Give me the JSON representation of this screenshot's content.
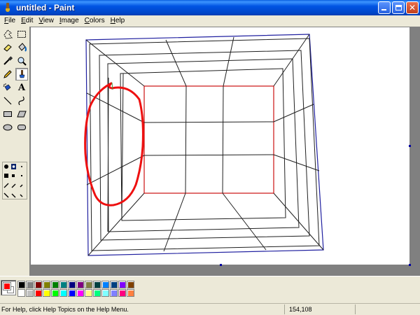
{
  "window": {
    "title": "untitled - Paint",
    "buttons": {
      "minimize": "minimize",
      "maximize": "maximize",
      "close": "✕"
    }
  },
  "menu": {
    "items": [
      "File",
      "Edit",
      "View",
      "Image",
      "Colors",
      "Help"
    ]
  },
  "toolbox": {
    "tools": [
      {
        "name": "free-form-select-icon"
      },
      {
        "name": "select-icon"
      },
      {
        "name": "eraser-icon"
      },
      {
        "name": "fill-icon"
      },
      {
        "name": "pick-color-icon"
      },
      {
        "name": "magnifier-icon"
      },
      {
        "name": "pencil-icon"
      },
      {
        "name": "brush-icon",
        "selected": true
      },
      {
        "name": "airbrush-icon"
      },
      {
        "name": "text-icon",
        "glyph": "A"
      },
      {
        "name": "line-icon"
      },
      {
        "name": "curve-icon"
      },
      {
        "name": "rectangle-icon"
      },
      {
        "name": "polygon-icon"
      },
      {
        "name": "ellipse-icon"
      },
      {
        "name": "rounded-rectangle-icon"
      }
    ]
  },
  "colors": {
    "foreground": "#ff0000",
    "background": "#ffffff",
    "palette": [
      "#000000",
      "#808080",
      "#800000",
      "#808000",
      "#008000",
      "#008080",
      "#000080",
      "#800080",
      "#808040",
      "#004040",
      "#0080ff",
      "#004080",
      "#8000ff",
      "#804000",
      "#ffffff",
      "#c0c0c0",
      "#ff0000",
      "#ffff00",
      "#00ff00",
      "#00ffff",
      "#0000ff",
      "#ff00ff",
      "#ffff80",
      "#00ff80",
      "#80ffff",
      "#8080ff",
      "#ff0080",
      "#ff8040"
    ]
  },
  "status": {
    "help_text": "For Help, click Help Topics on the Help Menu.",
    "coordinates": "154,108"
  }
}
